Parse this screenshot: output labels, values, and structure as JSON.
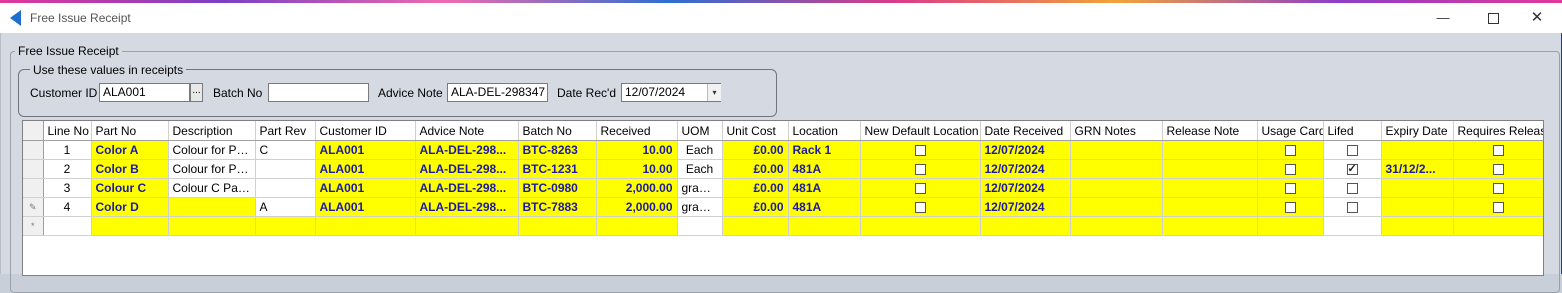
{
  "window": {
    "title": "Free Issue Receipt"
  },
  "outer_group": {
    "label": "Free Issue Receipt"
  },
  "defaults_group": {
    "label": "Use these values in receipts",
    "customer_id_label": "Customer ID",
    "customer_id": "ALA001",
    "lookup_label": "...",
    "batch_no_label": "Batch No",
    "batch_no": "",
    "advice_note_label": "Advice Note",
    "advice_note": "ALA-DEL-298347",
    "date_label": "Date Rec'd",
    "date": "12/07/2024"
  },
  "grid": {
    "columns": [
      "Line No",
      "Part No",
      "Description",
      "Part Rev",
      "Customer ID",
      "Advice Note",
      "Batch No",
      "Received",
      "UOM",
      "Unit Cost",
      "Location",
      "New Default Location",
      "Date Received",
      "GRN Notes",
      "Release Note",
      "Usage Card",
      "Lifed",
      "Expiry Date",
      "Requires Release"
    ],
    "rows": [
      {
        "line_no": "1",
        "part_no": "Color A",
        "description": "Colour for Plas...",
        "part_rev": "C",
        "customer_id": "ALA001",
        "advice_note": "ALA-DEL-298...",
        "batch_no": "BTC-8263",
        "received": "10.00",
        "uom": "Each",
        "unit_cost": "£0.00",
        "location": "Rack 1",
        "new_default_location": false,
        "date_received": "12/07/2024",
        "grn_notes": "",
        "release_note": "",
        "usage_card": false,
        "lifed": false,
        "expiry_date": "",
        "requires_release": false
      },
      {
        "line_no": "2",
        "part_no": "Color B",
        "description": "Colour for Plasti...",
        "part_rev": "",
        "customer_id": "ALA001",
        "advice_note": "ALA-DEL-298...",
        "batch_no": "BTC-1231",
        "received": "10.00",
        "uom": "Each",
        "unit_cost": "£0.00",
        "location": "481A",
        "new_default_location": false,
        "date_received": "12/07/2024",
        "grn_notes": "",
        "release_note": "",
        "usage_card": false,
        "lifed": true,
        "expiry_date": "31/12/2...",
        "requires_release": false
      },
      {
        "line_no": "3",
        "part_no": "Colour C",
        "description": "Colour C Paint",
        "part_rev": "",
        "customer_id": "ALA001",
        "advice_note": "ALA-DEL-298...",
        "batch_no": "BTC-0980",
        "received": "2,000.00",
        "uom": "gram...",
        "unit_cost": "£0.00",
        "location": "481A",
        "new_default_location": false,
        "date_received": "12/07/2024",
        "grn_notes": "",
        "release_note": "",
        "usage_card": false,
        "lifed": false,
        "expiry_date": "",
        "requires_release": false
      },
      {
        "line_no": "4",
        "part_no": "Color D",
        "description": "",
        "part_rev": "A",
        "customer_id": "ALA001",
        "advice_note": "ALA-DEL-298...",
        "batch_no": "BTC-7883",
        "received": "2,000.00",
        "uom": "gram...",
        "unit_cost": "£0.00",
        "location": "481A",
        "new_default_location": false,
        "date_received": "12/07/2024",
        "grn_notes": "",
        "release_note": "",
        "usage_card": false,
        "lifed": false,
        "expiry_date": "",
        "requires_release": false
      }
    ]
  }
}
